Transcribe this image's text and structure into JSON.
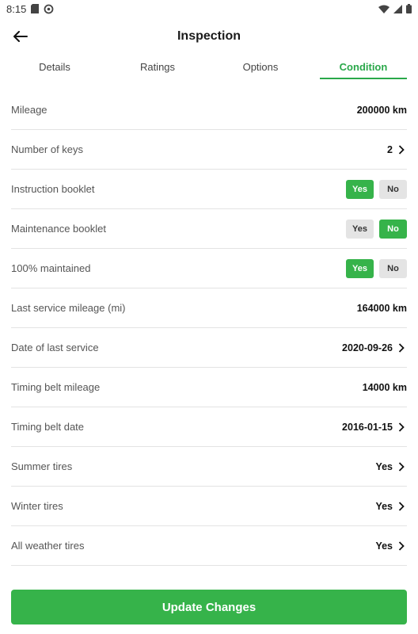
{
  "status_bar": {
    "time": "8:15"
  },
  "header": {
    "title": "Inspection"
  },
  "tabs": [
    {
      "label": "Details",
      "active": false
    },
    {
      "label": "Ratings",
      "active": false
    },
    {
      "label": "Options",
      "active": false
    },
    {
      "label": "Condition",
      "active": true
    }
  ],
  "rows": [
    {
      "label": "Mileage",
      "type": "value",
      "value": "200000 km",
      "chevron": false
    },
    {
      "label": "Number of keys",
      "type": "value",
      "value": "2",
      "chevron": true
    },
    {
      "label": "Instruction booklet",
      "type": "toggle",
      "yes_label": "Yes",
      "no_label": "No",
      "selected": "yes"
    },
    {
      "label": "Maintenance booklet",
      "type": "toggle",
      "yes_label": "Yes",
      "no_label": "No",
      "selected": "no"
    },
    {
      "label": "100% maintained",
      "type": "toggle",
      "yes_label": "Yes",
      "no_label": "No",
      "selected": "yes"
    },
    {
      "label": "Last service mileage (mi)",
      "type": "value",
      "value": "164000 km",
      "chevron": false
    },
    {
      "label": "Date of last service",
      "type": "value",
      "value": "2020-09-26",
      "chevron": true
    },
    {
      "label": "Timing belt mileage",
      "type": "value",
      "value": "14000 km",
      "chevron": false
    },
    {
      "label": "Timing belt date",
      "type": "value",
      "value": "2016-01-15",
      "chevron": true
    },
    {
      "label": "Summer tires",
      "type": "value",
      "value": "Yes",
      "chevron": true
    },
    {
      "label": "Winter tires",
      "type": "value",
      "value": "Yes",
      "chevron": true
    },
    {
      "label": "All weather tires",
      "type": "value",
      "value": "Yes",
      "chevron": true
    }
  ],
  "footer": {
    "update_label": "Update Changes"
  },
  "colors": {
    "accent": "#36b34a",
    "tab_active": "#2aa84a",
    "toggle_off": "#e4e4e4"
  }
}
